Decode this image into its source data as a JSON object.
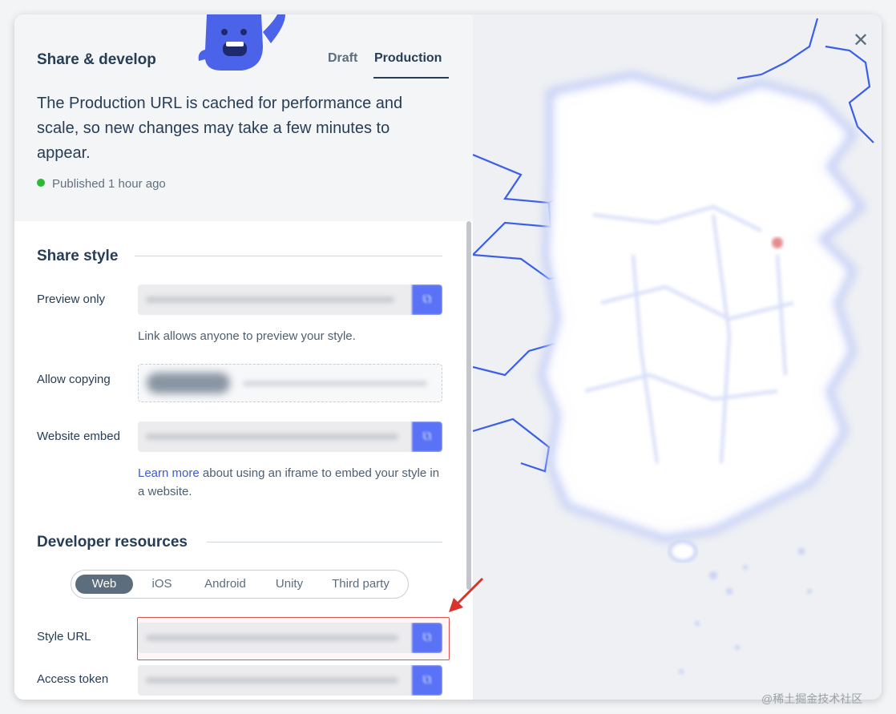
{
  "header": {
    "title": "Share & develop",
    "tabs": [
      {
        "label": "Draft",
        "active": false
      },
      {
        "label": "Production",
        "active": true
      }
    ],
    "info_text": "The Production URL is cached for performance and scale, so new changes may take a few minutes to appear.",
    "status_text": "Published 1 hour ago",
    "status_color": "#2db836"
  },
  "share_style": {
    "title": "Share style",
    "preview_label": "Preview only",
    "preview_help": "Link allows anyone to preview your style.",
    "copying_label": "Allow copying",
    "embed_label": "Website embed",
    "embed_help_link": "Learn more",
    "embed_help_rest": " about using an iframe to embed your style in a website."
  },
  "developer": {
    "title": "Developer resources",
    "platforms": [
      "Web",
      "iOS",
      "Android",
      "Unity",
      "Third party"
    ],
    "active_platform": "Web",
    "style_url_label": "Style URL",
    "access_token_label": "Access token"
  },
  "colors": {
    "accent": "#5a72f5",
    "text_dark": "#273d56",
    "highlight": "#d9534f"
  },
  "watermark": "@稀土掘金技术社区"
}
